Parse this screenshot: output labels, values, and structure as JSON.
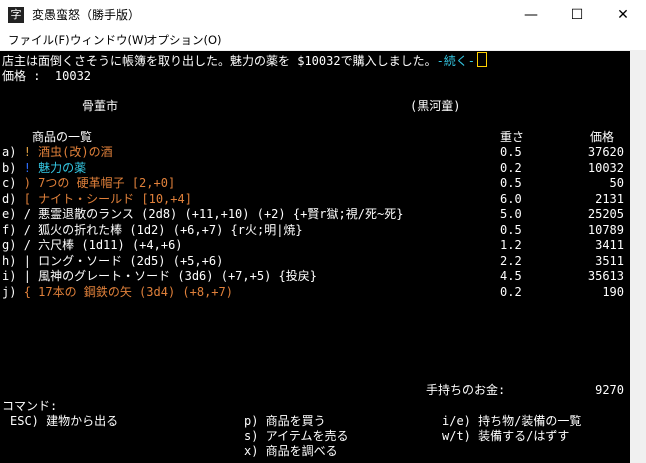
{
  "window": {
    "title": "変愚蛮怒（勝手版）",
    "menus": [
      "ファイル(F)",
      "ウィンドウ(W)",
      "オプション(O)"
    ],
    "min_glyph": "—",
    "max_glyph": "☐",
    "close_glyph": "✕"
  },
  "message": {
    "text": "店主は面倒くさそうに帳簿を取り出した。魅力の薬を $10032で購入しました。",
    "more": "-続く-"
  },
  "price_line": "価格 :  10032",
  "store": {
    "name": "骨董市",
    "owner": "(黒河童)",
    "header_title": "商品の一覧",
    "header_weight": "重さ",
    "header_price": "価格"
  },
  "items": [
    {
      "key": "a)",
      "sym": "!",
      "name": "酒虫(改)の酒",
      "weight": "0.5",
      "price": "37620",
      "sym_color": "#e0a040",
      "name_color": "#e0803a"
    },
    {
      "key": "b)",
      "sym": "!",
      "name": "魅力の薬",
      "weight": "0.2",
      "price": "10032",
      "sym_color": "#2f6fff",
      "name_color": "#34c7e3"
    },
    {
      "key": "c)",
      "sym": ")",
      "name": "7つの 硬革帽子 [2,+0]",
      "weight": "0.5",
      "price": "50",
      "sym_color": "#e0803a",
      "name_color": "#e0803a"
    },
    {
      "key": "d)",
      "sym": "[",
      "name": "ナイト・シールド [10,+4]",
      "weight": "6.0",
      "price": "2131",
      "sym_color": "#e0803a",
      "name_color": "#e0803a"
    },
    {
      "key": "e)",
      "sym": "/",
      "name": "悪霊退散のランス (2d8) (+11,+10) (+2) {+賢r獄;視/死~死}",
      "weight": "5.0",
      "price": "25205",
      "sym_color": "#ffffff",
      "name_color": "#ffffff"
    },
    {
      "key": "f)",
      "sym": "/",
      "name": "狐火の折れた棒 (1d2) (+6,+7) {r火;明|焼}",
      "weight": "0.5",
      "price": "10789",
      "sym_color": "#ffffff",
      "name_color": "#ffffff"
    },
    {
      "key": "g)",
      "sym": "/",
      "name": "六尺棒 (1d11) (+4,+6)",
      "weight": "1.2",
      "price": "3411",
      "sym_color": "#ffffff",
      "name_color": "#ffffff"
    },
    {
      "key": "h)",
      "sym": "|",
      "name": "ロング・ソード (2d5) (+5,+6)",
      "weight": "2.2",
      "price": "3511",
      "sym_color": "#ffffff",
      "name_color": "#ffffff"
    },
    {
      "key": "i)",
      "sym": "|",
      "name": "風神のグレート・ソード (3d6) (+7,+5) {投戻}",
      "weight": "4.5",
      "price": "35613",
      "sym_color": "#ffffff",
      "name_color": "#ffffff"
    },
    {
      "key": "j)",
      "sym": "{",
      "name": "17本の 鋼鉄の矢 (3d4) (+8,+7)",
      "weight": "0.2",
      "price": "190",
      "sym_color": "#e0803a",
      "name_color": "#e0803a"
    }
  ],
  "gold": {
    "label": "手持ちのお金:",
    "value": "9270"
  },
  "commands": {
    "title": "コマンド:",
    "esc": "ESC) 建物から出る",
    "buy": "p) 商品を買う",
    "sell": "s) アイテムを売る",
    "examine": "x) 商品を調べる",
    "inventory": "i/e) 持ち物/装備の一覧",
    "wield": "w/t) 装備する/はずす"
  }
}
